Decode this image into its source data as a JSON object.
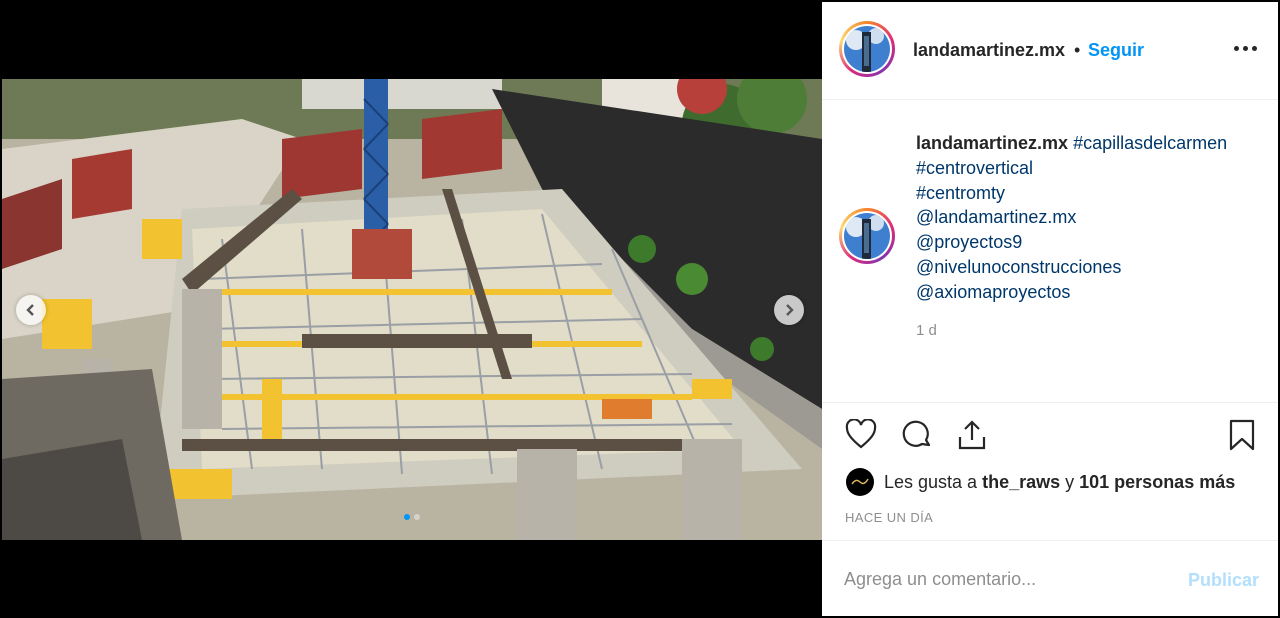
{
  "post": {
    "username": "landamartinez.mx",
    "separator": "•",
    "follow_label": "Seguir",
    "caption": {
      "username": "landamartinez.mx",
      "tags": [
        "#capillasdelcarmen",
        "#centrovertical",
        "#centromty",
        "@landamartinez.mx",
        "@proyectos9",
        "@niveluno­construcciones",
        "@axiomaproyectos"
      ]
    },
    "caption_time": "1 d",
    "likes": {
      "prefix": "Les gusta a ",
      "user": "the_raws",
      "middle": " y ",
      "count_text": "101 personas más"
    },
    "posted_ago": "HACE UN DÍA",
    "comment_placeholder": "Agrega un comentario...",
    "publish_label": "Publicar"
  },
  "media": {
    "alt": "construction site aerial photo",
    "carousel_index": 1,
    "carousel_total": 2
  },
  "icons": {
    "like": "heart-icon",
    "comment": "comment-icon",
    "share": "share-icon",
    "save": "bookmark-icon",
    "more": "more-options-icon",
    "prev": "chevron-left-icon",
    "next": "chevron-right-icon"
  },
  "colors": {
    "accent": "#0095f6",
    "link": "#00376b",
    "muted": "#8e8e8e",
    "publish_disabled": "#b2dffc"
  }
}
